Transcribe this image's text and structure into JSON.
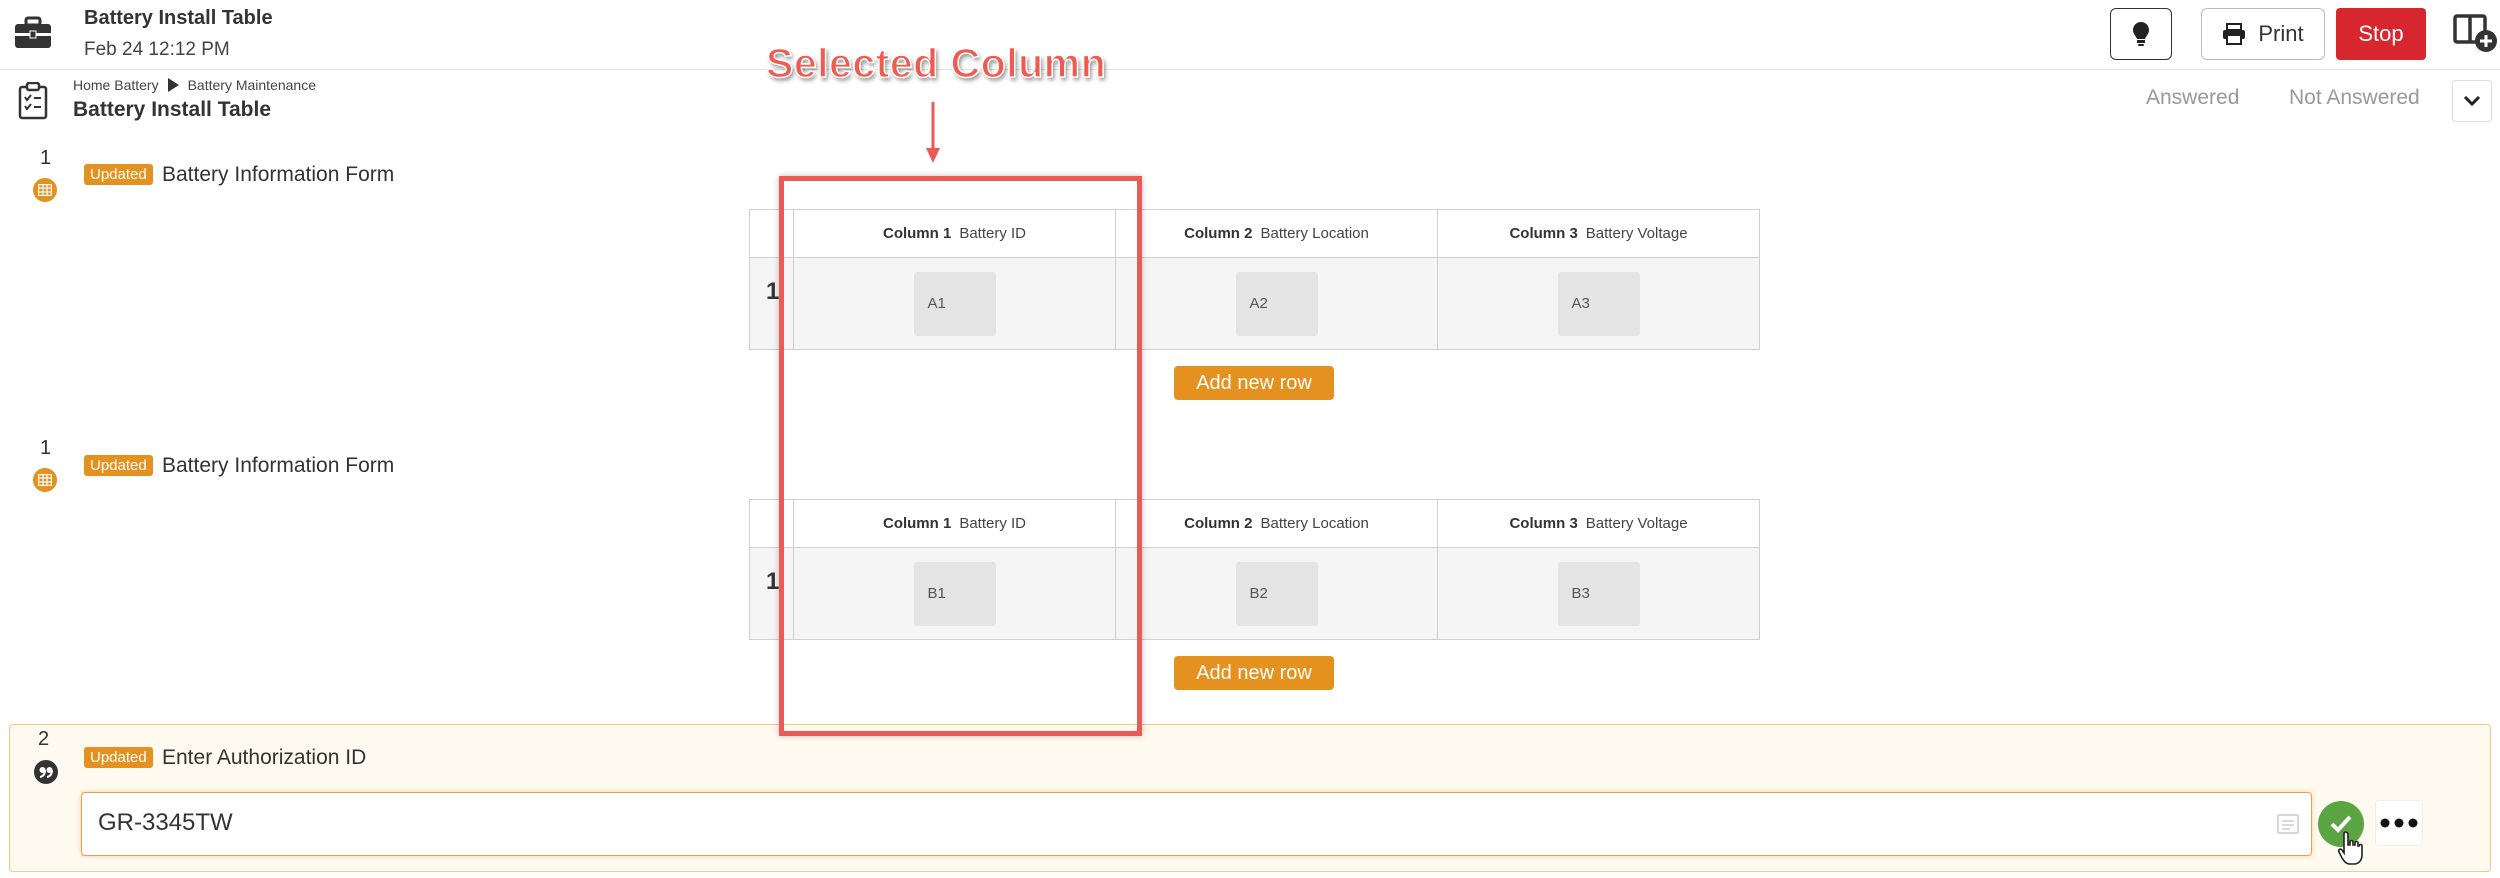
{
  "header": {
    "title": "Battery Install Table",
    "timestamp": "Feb 24 12:12 PM",
    "print_label": "Print",
    "stop_label": "Stop"
  },
  "subheader": {
    "breadcrumb": [
      "Home Battery",
      "Battery Maintenance"
    ],
    "form_title": "Battery Install Table",
    "filter_answered": "Answered",
    "filter_not_answered": "Not Answered"
  },
  "annotation": {
    "label": "Selected Column",
    "color": "#ec5a55"
  },
  "questions": [
    {
      "number": "1",
      "badge": "Updated",
      "title": "Battery Information Form",
      "icon": "table-icon",
      "columns": [
        {
          "num": "Column 1",
          "name": "Battery ID"
        },
        {
          "num": "Column 2",
          "name": "Battery Location"
        },
        {
          "num": "Column 3",
          "name": "Battery Voltage"
        }
      ],
      "rows": [
        {
          "num": "1",
          "cells": [
            "A1",
            "A2",
            "A3"
          ]
        }
      ],
      "add_row_label": "Add new row"
    },
    {
      "number": "1",
      "badge": "Updated",
      "title": "Battery Information Form",
      "icon": "table-icon",
      "columns": [
        {
          "num": "Column 1",
          "name": "Battery ID"
        },
        {
          "num": "Column 2",
          "name": "Battery Location"
        },
        {
          "num": "Column 3",
          "name": "Battery Voltage"
        }
      ],
      "rows": [
        {
          "num": "1",
          "cells": [
            "B1",
            "B2",
            "B3"
          ]
        }
      ],
      "add_row_label": "Add new row"
    },
    {
      "number": "2",
      "badge": "Updated",
      "title": "Enter Authorization ID",
      "icon": "quote-icon",
      "input_value": "GR-3345TW"
    }
  ],
  "colors": {
    "accent_orange": "#e4911f",
    "stop_red": "#d8262e",
    "confirm_green": "#5aa542"
  }
}
